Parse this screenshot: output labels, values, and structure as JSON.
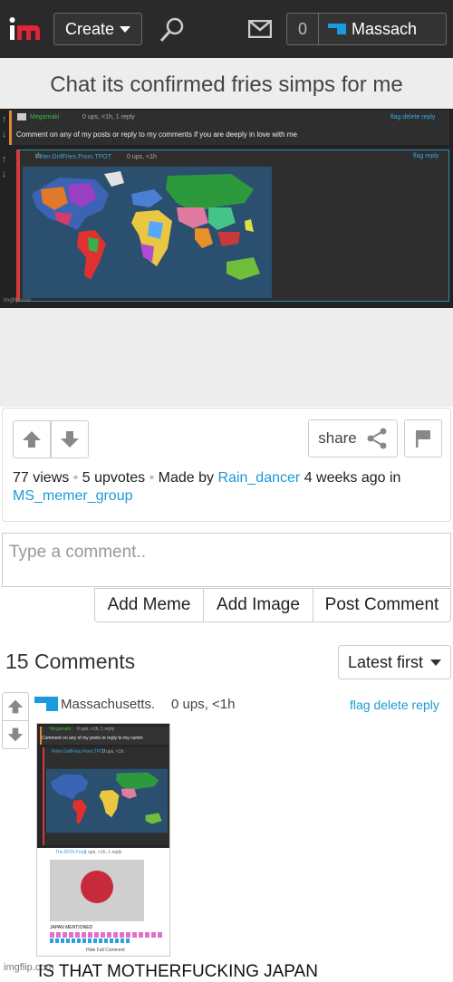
{
  "header": {
    "create_label": "Create",
    "notifications": "0",
    "username": "Massach"
  },
  "meme": {
    "title": "Chat its confirmed fries simps for me",
    "inner_comment_1": {
      "user": "Megamaki",
      "meta": "0 ups, <1h, 1 reply",
      "links": "flag delete reply",
      "body": "Comment on any of my posts or reply to my comments if you are deeply in love with me"
    },
    "inner_comment_2": {
      "user": "Peter.GrifFries.From.TPOT",
      "meta": "0 ups, <1h",
      "links": "flag reply"
    },
    "watermark": "imgflip.com"
  },
  "actions": {
    "share_label": "share",
    "views": "77 views",
    "upvotes": "5 upvotes",
    "made_by": "Made by",
    "author": "Rain_dancer",
    "time": "4 weeks ago in",
    "stream": "MS_memer_group"
  },
  "comment_input": {
    "placeholder": "Type a comment.."
  },
  "buttons": {
    "add_meme": "Add Meme",
    "add_image": "Add Image",
    "post_comment": "Post Comment"
  },
  "comments": {
    "count_label": "15 Comments",
    "sort_label": "Latest first",
    "first": {
      "user": "Massachusetts.",
      "meta": "0 ups, <1h",
      "links": "flag  delete  reply",
      "thumb_user_1": "Megamaki",
      "thumb_meta_1": "0 ups, <1h, 1 reply",
      "thumb_body_1": "Comment on any of my posts or reply to my comm",
      "thumb_user_2": "Peter.GrifFries.From.TPOT",
      "thumb_meta_2": "0 ups, <1h",
      "thumb_user_3": "The.BFDI.Frog",
      "thumb_meta_3": "1 ups, <1h, 1 reply",
      "thumb_body_3": "JAPAN MENTIONED",
      "thumb_hide": "Hide Full Comment",
      "text": "IS THAT MOTHERFUCKING JAPAN"
    },
    "watermark": "imgflip.com"
  },
  "colors": {
    "link": "#1b9bd7",
    "header_bg": "#2a2a2a",
    "logo_red": "#e0243a"
  }
}
